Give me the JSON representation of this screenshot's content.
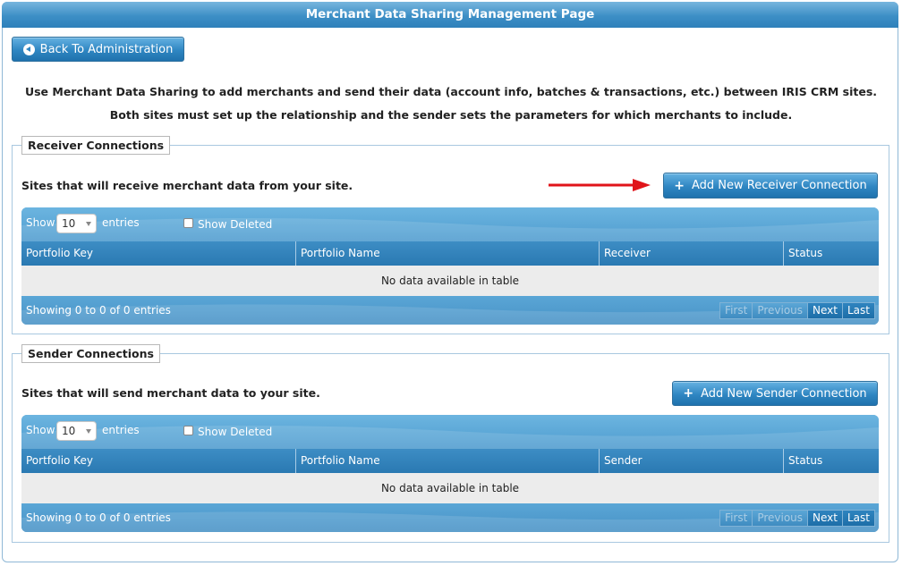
{
  "page": {
    "title": "Merchant Data Sharing Management Page"
  },
  "back_button": {
    "label": "Back To Administration"
  },
  "intro": {
    "line1": "Use Merchant Data Sharing to add merchants and send their data (account info, batches & transactions, etc.) between IRIS CRM sites.",
    "line2": "Both sites must set up the relationship and the sender sets the parameters for which merchants to include."
  },
  "receiver": {
    "legend": "Receiver Connections",
    "description": "Sites that will receive merchant data from your site.",
    "add_button": "Add New Receiver Connection",
    "table": {
      "show_label": "Show",
      "length_value": "10",
      "entries_label": "entries",
      "show_deleted_label": "Show Deleted",
      "columns": [
        "Portfolio Key",
        "Portfolio Name",
        "Receiver",
        "Status"
      ],
      "empty_message": "No data available in table",
      "info": "Showing 0 to 0 of 0 entries",
      "pager": {
        "first": "First",
        "previous": "Previous",
        "next": "Next",
        "last": "Last"
      }
    }
  },
  "sender": {
    "legend": "Sender Connections",
    "description": "Sites that will send merchant data to your site.",
    "add_button": "Add New Sender Connection",
    "table": {
      "show_label": "Show",
      "length_value": "10",
      "entries_label": "entries",
      "show_deleted_label": "Show Deleted",
      "columns": [
        "Portfolio Key",
        "Portfolio Name",
        "Sender",
        "Status"
      ],
      "empty_message": "No data available in table",
      "info": "Showing 0 to 0 of 0 entries",
      "pager": {
        "first": "First",
        "previous": "Previous",
        "next": "Next",
        "last": "Last"
      }
    }
  },
  "icons": {
    "back": "back-circle-icon",
    "add": "plus-icon",
    "arrow": "red-arrow-icon",
    "caret": "caret-down-icon"
  },
  "colors": {
    "accent": "#2f86c2",
    "arrow": "#e0141a",
    "header": "#3d8fc6"
  }
}
